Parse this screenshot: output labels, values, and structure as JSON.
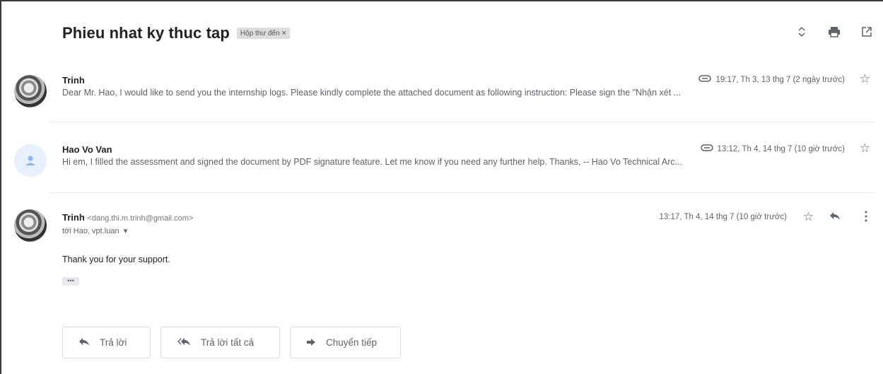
{
  "thread": {
    "subject": "Phieu nhat ky thuc tap",
    "label": "Hộp thư đến",
    "label_remove": "×"
  },
  "toolbar": {
    "expand_icon": "unfold-icon",
    "print_icon": "print-icon",
    "popout_icon": "open-in-new-window-icon"
  },
  "messages": [
    {
      "sender": "Trinh",
      "snippet": "Dear Mr. Hao, I would like to send you the internship logs. Please kindly complete the attached document as following instruction: Please sign the \"Nhận xét ...",
      "timestamp": "19:17, Th 3, 13 thg 7 (2 ngày trước)",
      "has_attachment": true
    },
    {
      "sender": "Hao Vo Van",
      "snippet": "Hi em, I filled the assessment and signed the document by PDF signature feature. Let me know if you need any further help. Thanks, -- Hao Vo Technical Arc...",
      "timestamp": "13:12, Th 4, 14 thg 7 (10 giờ trước)",
      "has_attachment": true
    },
    {
      "sender": "Trinh",
      "email": "<dang.thi.m.trinh@gmail.com>",
      "recipients": "tới Hao, vpt.luan",
      "timestamp": "13:17, Th 4, 14 thg 7 (10 giờ trước)",
      "body": "Thank you for your support.",
      "quoted_toggle": "•••"
    }
  ],
  "actions": {
    "reply": "Trả lời",
    "reply_all": "Trả lời tất cả",
    "forward": "Chuyển tiếp"
  },
  "colors": {
    "text_primary": "#222222",
    "text_secondary": "#5f6368",
    "label_bg": "#dddddd",
    "border": "#dadce0"
  }
}
